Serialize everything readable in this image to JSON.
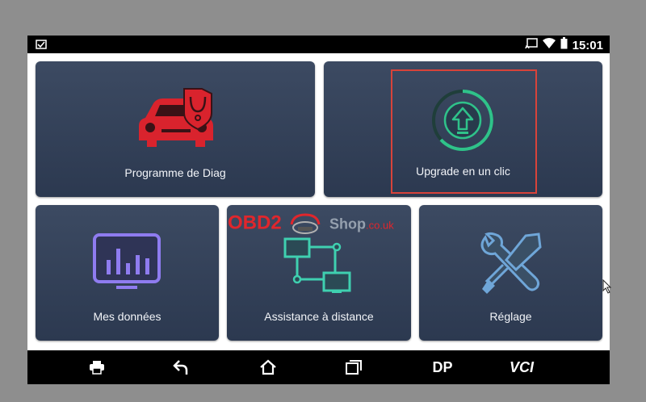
{
  "status": {
    "time": "15:01",
    "icons": [
      "notification-icon",
      "cast-icon",
      "wifi-icon",
      "battery-icon"
    ]
  },
  "tiles": {
    "diag": {
      "label": "Programme de Diag",
      "icon": "car-diagnostic-icon",
      "icon_color": "#d9232d"
    },
    "upgrade": {
      "label": "Upgrade en un clic",
      "icon": "upgrade-arrow-icon",
      "icon_color": "#2fc28a"
    },
    "data": {
      "label": "Mes données",
      "icon": "data-chart-icon",
      "icon_color": "#8f7cf0"
    },
    "remote": {
      "label": "Assistance à distance",
      "icon": "remote-network-icon",
      "icon_color": "#3fd0b0"
    },
    "settings": {
      "label": "Réglage",
      "icon": "tools-icon",
      "icon_color": "#6fa6d8"
    }
  },
  "watermark": {
    "brand": "OBD2",
    "shop": "Shop",
    "domain": ".co.uk"
  },
  "navbar": {
    "print": "print-icon",
    "back": "back-icon",
    "home": "home-icon",
    "recent": "recent-apps-icon",
    "dp_label": "DP",
    "vci_label": "VCI"
  },
  "colors": {
    "tile_bg": "#34425a",
    "highlight": "#d8433a",
    "watermark_red": "#e0262c"
  }
}
